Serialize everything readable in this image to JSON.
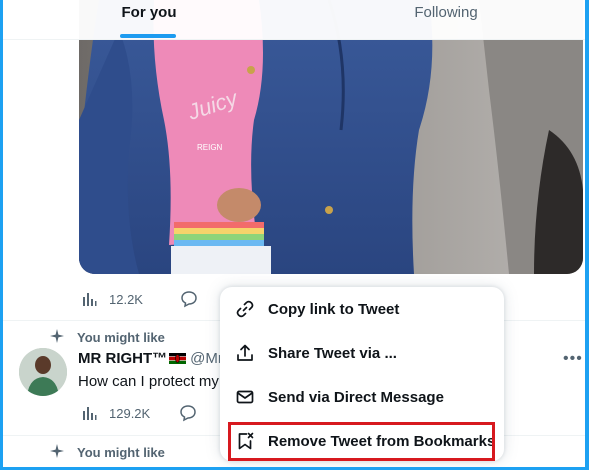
{
  "tabs": [
    {
      "label": "For you",
      "active": true
    },
    {
      "label": "Following",
      "active": false
    }
  ],
  "first_tweet": {
    "views": "12.2K",
    "shirt_text": "REIGN"
  },
  "recommended": {
    "label": "You might like",
    "author_name": "MR RIGHT™",
    "author_handle": "@Mr",
    "text": "How can I protect my",
    "views": "129.2K"
  },
  "second_recommended": {
    "label": "You might like"
  },
  "menu": {
    "items": [
      {
        "label": "Copy link to Tweet",
        "icon": "link-icon"
      },
      {
        "label": "Share Tweet via ...",
        "icon": "share-icon"
      },
      {
        "label": "Send via Direct Message",
        "icon": "envelope-icon"
      },
      {
        "label": "Remove Tweet from Bookmarks",
        "icon": "bookmark-remove-icon"
      }
    ],
    "highlighted_item": "Remove Tweet from Bookmarks"
  },
  "colors": {
    "accent": "#1d9bf0",
    "highlight_box": "#d7191f",
    "frame": "#1da1f2"
  }
}
